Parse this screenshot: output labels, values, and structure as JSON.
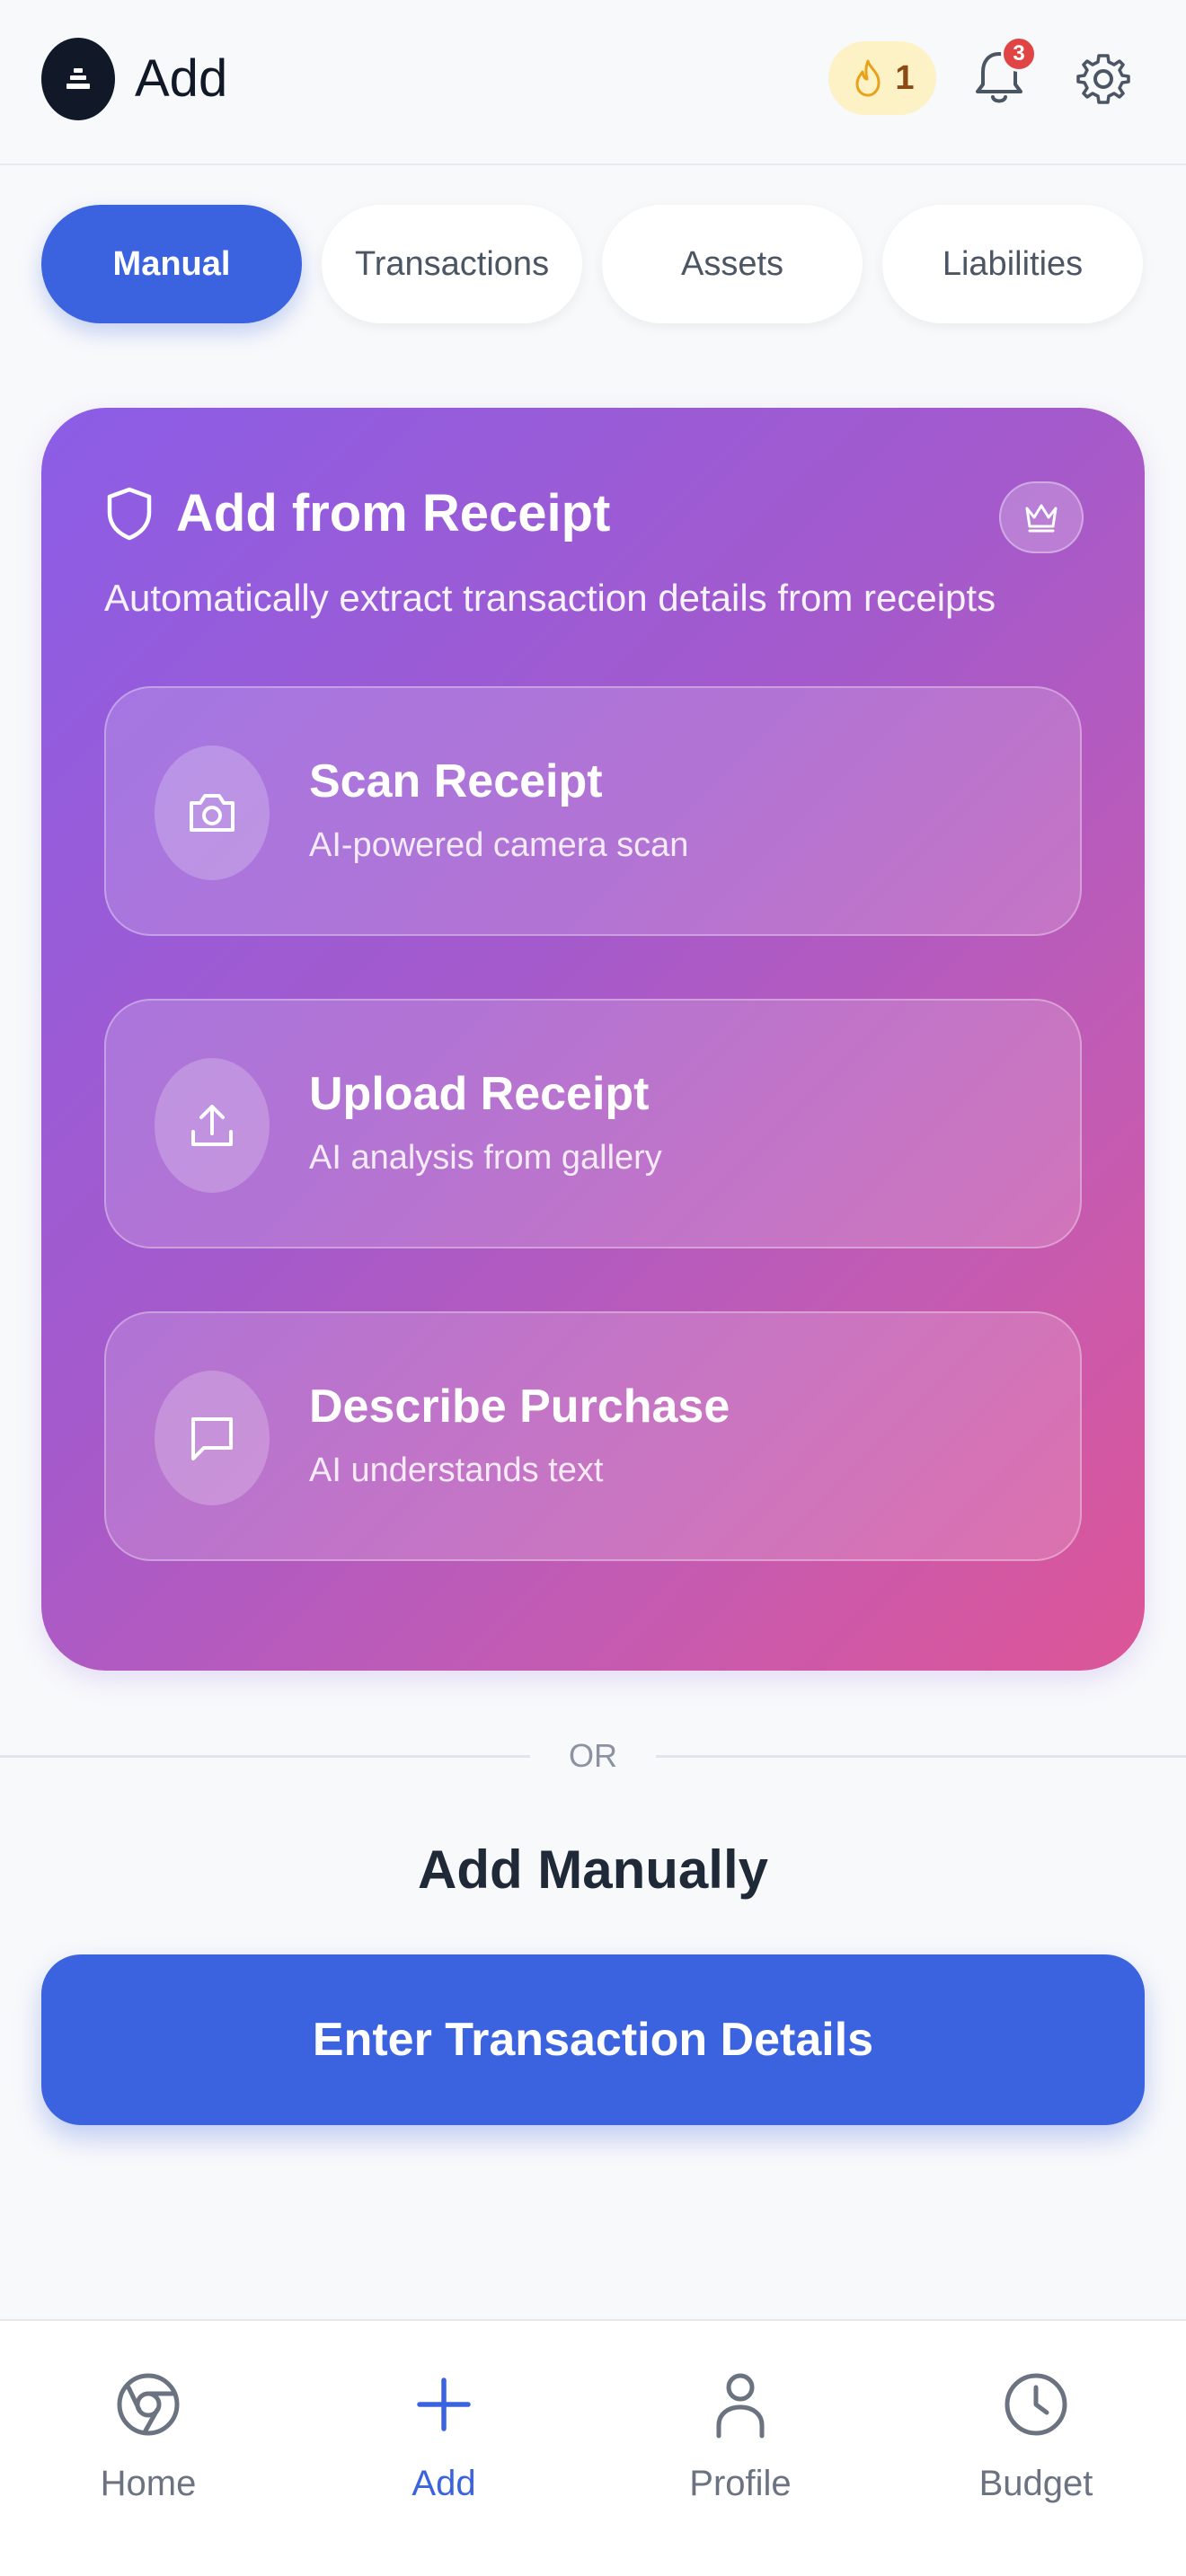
{
  "header": {
    "title": "Add",
    "streak_count": "1",
    "notification_count": "3"
  },
  "tabs": [
    {
      "label": "Manual",
      "active": true
    },
    {
      "label": "Transactions",
      "active": false
    },
    {
      "label": "Assets",
      "active": false
    },
    {
      "label": "Liabilities",
      "active": false
    }
  ],
  "receipt_card": {
    "title": "Add from Receipt",
    "subtitle": "Automatically extract transaction details from receipts",
    "options": [
      {
        "title": "Scan Receipt",
        "description": "AI-powered camera scan",
        "icon": "camera-icon"
      },
      {
        "title": "Upload Receipt",
        "description": "AI analysis from gallery",
        "icon": "upload-icon"
      },
      {
        "title": "Describe Purchase",
        "description": "AI understands text",
        "icon": "chat-icon"
      }
    ]
  },
  "divider": {
    "label": "OR"
  },
  "manual": {
    "heading": "Add Manually",
    "button_label": "Enter Transaction Details"
  },
  "bottom_nav": [
    {
      "label": "Home",
      "icon": "home-icon",
      "active": false
    },
    {
      "label": "Add",
      "icon": "plus-icon",
      "active": true
    },
    {
      "label": "Profile",
      "icon": "person-icon",
      "active": false
    },
    {
      "label": "Budget",
      "icon": "clock-icon",
      "active": false
    }
  ],
  "colors": {
    "accent": "#3b63e0",
    "gradient_start": "#8b5de6",
    "gradient_end": "#dd5597",
    "badge": "#e04444",
    "streak_bg": "#fdf1c6"
  }
}
